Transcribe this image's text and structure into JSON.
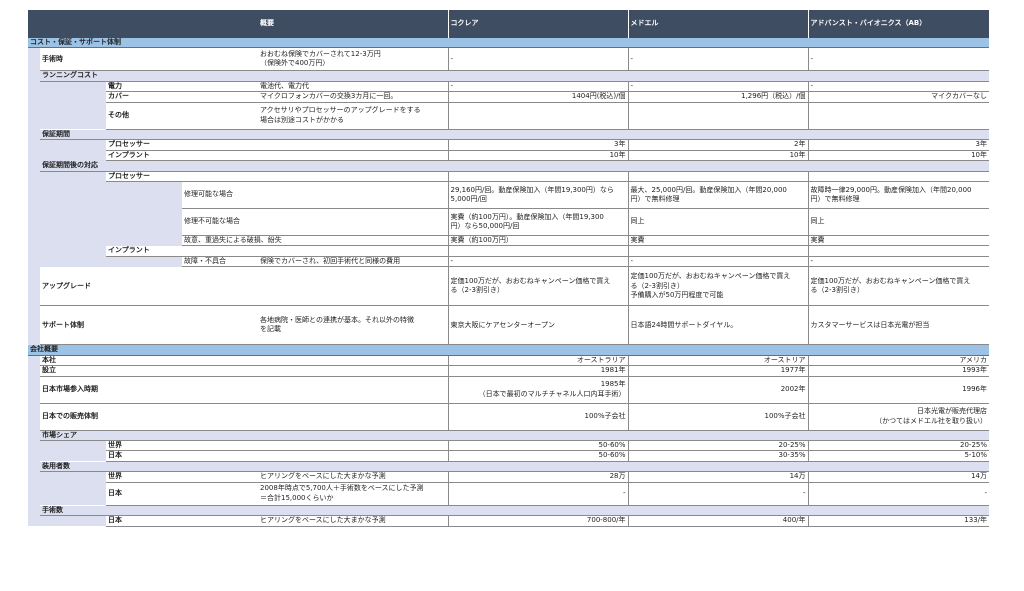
{
  "header": {
    "summary": "概要",
    "vendor1": "コクレア",
    "vendor2": "メドエル",
    "vendor3": "アドバンスト・バイオニクス（AB）"
  },
  "sections": {
    "cost": "コスト・保証・サポート体制",
    "company": "会社概要"
  },
  "rows": {
    "surgery": {
      "label": "手術時",
      "summary_line1": "おおむね保険でカバーされて12-3万円",
      "summary_line2": "（保険外で400万円）",
      "v1": "-",
      "v2": "-",
      "v3": "-"
    },
    "running": {
      "label": "ランニングコスト"
    },
    "power": {
      "label": "電力",
      "summary": "電池代、電力代",
      "v1": "-",
      "v2": "-",
      "v3": "-"
    },
    "cover": {
      "label": "カバー",
      "summary": "マイクロフォンカバーの交換3カ月に一回。",
      "v1": "1404円(税込)/個",
      "v2": "1,296円（税込）/個",
      "v3": "マイクカバーなし"
    },
    "other": {
      "label": "その他",
      "summary_line1": "アクセサリやプロセッサーのアップグレードをする",
      "summary_line2": "場合は別途コストがかかる"
    },
    "warranty": {
      "label": "保証期間"
    },
    "w_processor": {
      "label": "プロセッサー",
      "v1": "3年",
      "v2": "2年",
      "v3": "3年"
    },
    "w_implant": {
      "label": "インプラント",
      "v1": "10年",
      "v2": "10年",
      "v3": "10年"
    },
    "after": {
      "label": "保証期間後の対応"
    },
    "a_processor": {
      "label": "プロセッサー"
    },
    "repairable": {
      "label": "修理可能な場合",
      "v1_line1": "29,160円/回。動産保険加入（年間19,300円）なら",
      "v1_line2": "5,000円/回",
      "v2_line1": "最大、25,000円/回。動産保険加入（年間20,000",
      "v2_line2": "円）で無料修理",
      "v3_line1": "故障時一律29,000円。動産保険加入（年間20,000",
      "v3_line2": "円）で無料修理"
    },
    "unrepairable": {
      "label": "修理不可能な場合",
      "v1_line1": "実費（約100万円）。動産保険加入（年間19,300",
      "v1_line2": "円）なら50,000円/回",
      "v2": "同上",
      "v3": "同上"
    },
    "intentional": {
      "label": "故意、重過失による破損、紛失",
      "v1": "実費（約100万円）",
      "v2": "実費",
      "v3": "実費"
    },
    "a_implant": {
      "label": "インプラント"
    },
    "failure": {
      "label": "故障・不具合",
      "summary": "保険でカバーされ、初回手術代と同様の費用",
      "v1": "-",
      "v2": "-",
      "v3": "-"
    },
    "upgrade": {
      "label": "アップグレード",
      "v1_line1": "定価100万だが、おおむねキャンペーン価格で買え",
      "v1_line2": "る（2-3割引き）",
      "v2_line1": "定価100万だが、おおむねキャンペーン価格で買え",
      "v2_line2": "る（2-3割引き）",
      "v2_line3": "予備購入が50万円程度で可能",
      "v3_line1": "定価100万だが、おおむねキャンペーン価格で買え",
      "v3_line2": "る（2-3割引き）"
    },
    "support": {
      "label": "サポート体制",
      "summary_line1": "各地病院・医師との連携が基本。それ以外の特徴",
      "summary_line2": "を記載",
      "v1": "東京大阪にケアセンターオープン",
      "v2": "日本語24時間サポートダイヤル。",
      "v3": "カスタマーサービスは日本光電が担当"
    },
    "hq": {
      "label": "本社",
      "v1": "オーストラリア",
      "v2": "オーストリア",
      "v3": "アメリカ"
    },
    "founded": {
      "label": "設立",
      "v1": "1981年",
      "v2": "1977年",
      "v3": "1993年"
    },
    "entry": {
      "label": "日本市場参入時期",
      "v1_line1": "1985年",
      "v1_line2": "（日本で最初のマルチチャネル人口内耳手術）",
      "v2": "2002年",
      "v3": "1996年"
    },
    "sales": {
      "label": "日本での販売体制",
      "v1": "100%子会社",
      "v2": "100%子会社",
      "v3_line1": "日本光電が販売代理店",
      "v3_line2": "（かつてはメドエル社を取り扱い）"
    },
    "share": {
      "label": "市場シェア"
    },
    "share_world": {
      "label": "世界",
      "v1": "50-60%",
      "v2": "20-25%",
      "v3": "20-25%"
    },
    "share_japan": {
      "label": "日本",
      "v1": "50-60%",
      "v2": "30-35%",
      "v3": "5-10%"
    },
    "users": {
      "label": "装用者数"
    },
    "users_world": {
      "label": "世界",
      "summary": "ヒアリングをベースにした大まかな予測",
      "v1": "28万",
      "v2": "14万",
      "v3": "14万"
    },
    "users_japan": {
      "label": "日本",
      "summary_line1": "2008年時点で5,700人＋手術数をベースにした予測",
      "summary_line2": "＝合計15,000くらいか",
      "v1": "-",
      "v2": "-",
      "v3": "-"
    },
    "surgeries": {
      "label": "手術数"
    },
    "surgeries_japan": {
      "label": "日本",
      "summary": "ヒアリングをベースにした大まかな予測",
      "v1": "700-800/年",
      "v2": "400/年",
      "v3": "133/年"
    }
  }
}
